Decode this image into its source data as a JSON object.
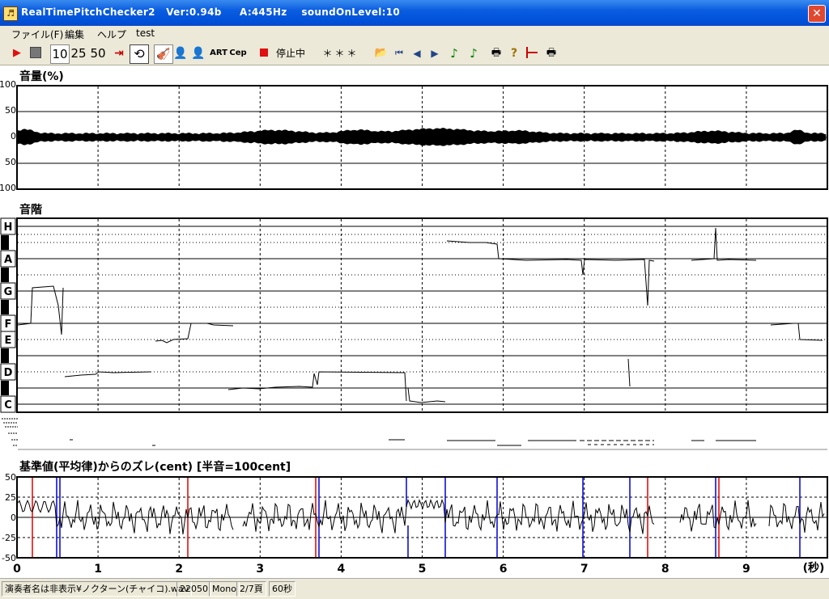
{
  "window": {
    "title": "RealTimePitchChecker2   Ver:0.94b     A:445Hz    soundOnLevel:10",
    "close_glyph": "✕"
  },
  "menu": [
    "ファイル(F)",
    "編集",
    "ヘルプ",
    "test"
  ],
  "toolbar": {
    "zoom_options": [
      "10",
      "25",
      "50"
    ],
    "status": "停止中",
    "display": "＊＊＊",
    "labels": {
      "art": "ART",
      "cep": "Cep"
    }
  },
  "volume_panel": {
    "title": "音量(%)",
    "y_labels": [
      "100",
      "50",
      "0",
      "50",
      "100"
    ]
  },
  "scale_panel": {
    "title": "音階",
    "notes": [
      "H",
      "A",
      "G",
      "F",
      "E",
      "D",
      "C"
    ]
  },
  "deviation_panel": {
    "title": "基準値(平均律)からのズレ(cent) [半音=100cent]",
    "y_labels": [
      "50",
      "25",
      "0",
      "-25",
      "-50"
    ]
  },
  "x_axis": {
    "labels": [
      "0",
      "1",
      "2",
      "3",
      "4",
      "5",
      "6",
      "7",
      "8",
      "9"
    ],
    "unit": "(秒)"
  },
  "status": {
    "file": "演奏者名は非表示¥ノクターン(チャイコ).wav",
    "rate": "22050",
    "channels": "Mono",
    "page": "2/7頁",
    "duration": "60秒"
  }
}
